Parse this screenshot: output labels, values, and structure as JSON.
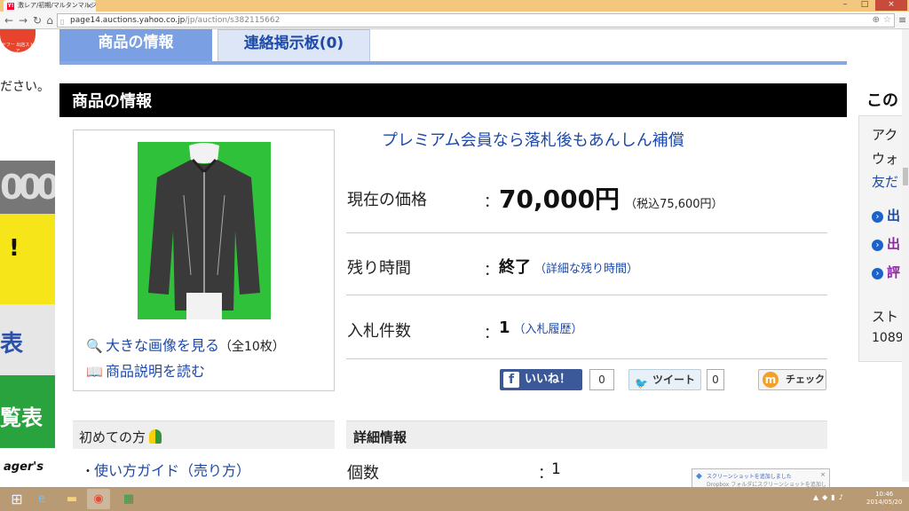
{
  "browser": {
    "tab_title": "激レア/初期/マルタンマルジェ",
    "favicon_text": "Y!",
    "url_host": "page14.auctions.yahoo.co.jp",
    "url_path": "/jp/auction/s382115662"
  },
  "left": {
    "badge_text": "ヤフー 出店ストア",
    "partial_text": "ださい。",
    "banner1": "000",
    "banner2": "!",
    "banner3": "表",
    "banner4": "覧表",
    "banner5": "ager's"
  },
  "tabs": [
    {
      "label": "商品の情報"
    },
    {
      "label": "連絡掲示板(0)"
    }
  ],
  "section_title": "商品の情報",
  "image_box": {
    "view_large": "大きな画像を見る",
    "view_large_count": "（全10枚）",
    "read_description": "商品説明を読む"
  },
  "info": {
    "premium": "プレミアム会員なら落札後もあんしん補償",
    "price_label": "現在の価格",
    "price_value": "70,000円",
    "price_tax": "（税込75,600円）",
    "time_label": "残り時間",
    "time_value": "終了",
    "time_link": "（詳細な残り時間）",
    "bids_label": "入札件数",
    "bids_value": "1",
    "bids_link": "（入札履歴）",
    "colon": "："
  },
  "social": {
    "like_label": "いいね！",
    "like_count": "0",
    "tweet_label": "ツイート",
    "tweet_count": "0",
    "mixi_label": "チェック"
  },
  "first_time": {
    "title": "初めての方",
    "guide_link": "使い方ガイド（売り方）"
  },
  "details": {
    "title": "詳細情報",
    "qty_label": "個数",
    "qty_value": "1"
  },
  "right": {
    "title": "この",
    "line1": "アク",
    "line2": "ウォ",
    "link1": "友だ",
    "item1": "出",
    "item2": "出",
    "item3": "評",
    "line3": "スト",
    "line4": "1089"
  },
  "taskbar": {
    "time": "10:46",
    "date": "2014/05/20"
  },
  "toast": {
    "title": "スクリーンショットを追加しました",
    "body": "Dropbox フォルダにスクリーンショットを追加しました"
  },
  "colors": {
    "tab_active": "#7a9fe2",
    "link": "#1d4aa8",
    "header_bg": "#000000",
    "facebook": "#3b5998"
  }
}
